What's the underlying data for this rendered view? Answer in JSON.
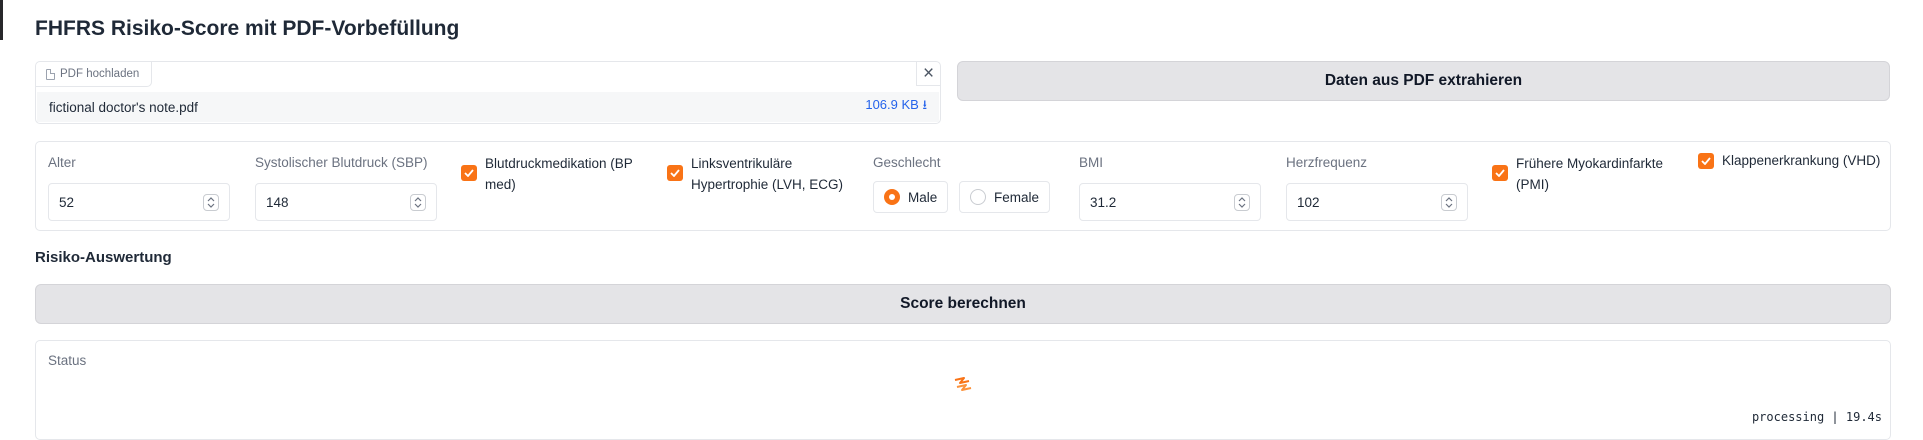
{
  "app": {
    "title": "FHFRS Risiko-Score mit PDF-Vorbefüllung"
  },
  "upload": {
    "tag_label": "PDF hochladen",
    "file_name": "fictional doctor's note.pdf",
    "file_size": "106.9 KB ⭳"
  },
  "extract_button": "Daten aus PDF extrahieren",
  "form": {
    "age": {
      "label": "Alter",
      "value": "52"
    },
    "sbp": {
      "label": "Systolischer Blutdruck (SBP)",
      "value": "148"
    },
    "bp_med": {
      "label_line1": "Blutdruckmedikation (BP",
      "label_line2": "med)",
      "checked": true
    },
    "lvh": {
      "label_line1": "Linksventrikuläre",
      "label_line2": "Hypertrophie (LVH, ECG)",
      "checked": true
    },
    "sex": {
      "label": "Geschlecht",
      "options": [
        "Male",
        "Female"
      ],
      "selected": "Male"
    },
    "bmi": {
      "label": "BMI",
      "value": "31.2"
    },
    "heart_rate": {
      "label": "Herzfrequenz",
      "value": "102"
    },
    "pmi": {
      "label_line1": "Frühere Myokardinfarkte",
      "label_line2": "(PMI)",
      "checked": true
    },
    "vhd": {
      "label": "Klappenerkrankung (VHD)",
      "checked": true
    }
  },
  "evaluation": {
    "section_title": "Risiko-Auswertung",
    "score_button": "Score berechnen"
  },
  "status": {
    "label": "Status",
    "progress": "processing | 19.4s"
  },
  "colors": {
    "accent": "#f97316",
    "link": "#2563eb",
    "button_bg": "#e4e4e7"
  }
}
